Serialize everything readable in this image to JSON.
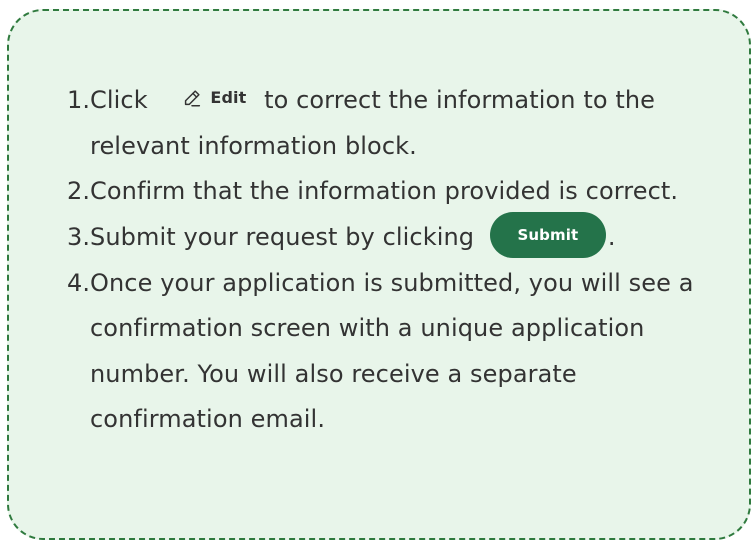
{
  "steps": [
    {
      "number": "1.",
      "before": "Click",
      "button": "Edit",
      "after": " to correct the information  to the relevant information block."
    },
    {
      "number": "2.",
      "text": "Confirm that the information provided is correct."
    },
    {
      "number": "3.",
      "before": "Submit your request by clicking",
      "button": "Submit",
      "after": "."
    },
    {
      "number": "4.",
      "text": "Once your application is submitted, you will see a confirmation screen with a unique application number. You will also receive a separate confirmation email."
    }
  ],
  "icons": {
    "edit": "pencil-icon"
  },
  "colors": {
    "card_background": "#e8f5ea",
    "card_border": "#2f7a3e",
    "submit_background": "#24734a",
    "text": "#333333"
  }
}
